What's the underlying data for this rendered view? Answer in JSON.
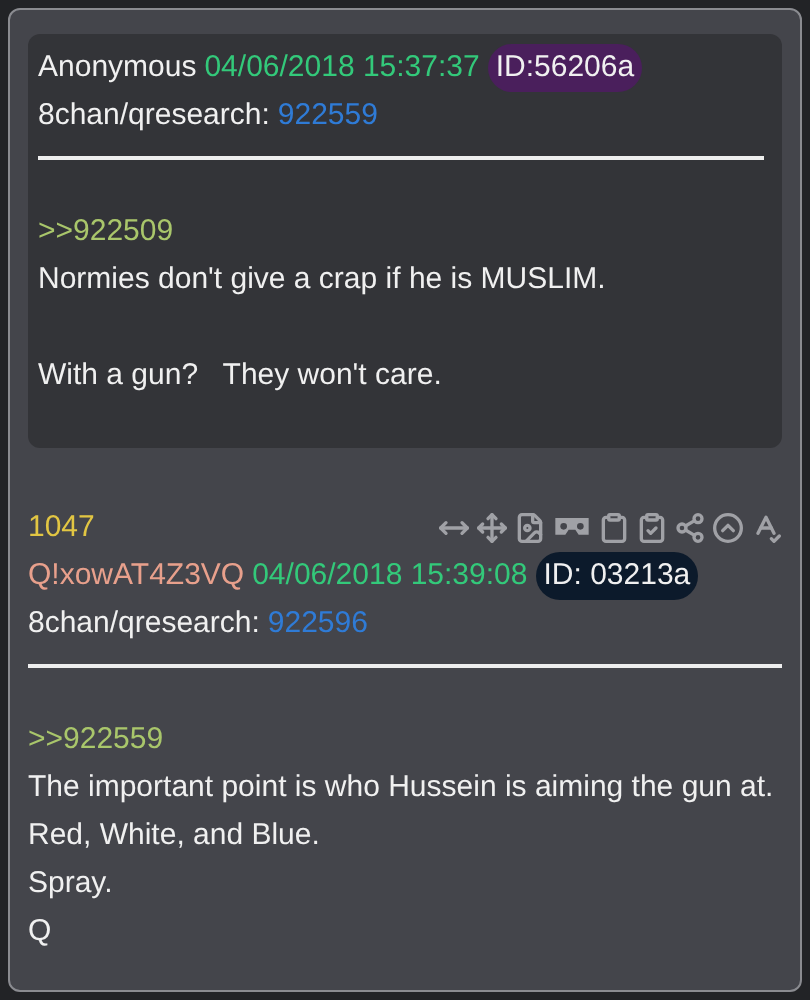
{
  "quoted_post": {
    "author": "Anonymous",
    "timestamp": "04/06/2018 15:37:37",
    "id_badge": "ID:56206a",
    "board": "8chan/qresearch:",
    "post_number": "922559",
    "reply_link": ">>922509",
    "paragraphs": [
      [
        "Normies don't give a crap if he is MUSLIM."
      ],
      [
        "With a gun?   They won't care."
      ]
    ]
  },
  "post": {
    "count": "1047",
    "tripcode": "Q!xowAT4Z3VQ",
    "timestamp": "04/06/2018 15:39:08",
    "id_badge": "ID: 03213a",
    "board": "8chan/qresearch:",
    "post_number": "922596",
    "reply_link": ">>922559",
    "paragraphs": [
      [
        "The important point is who Hussein is aiming the gun at.",
        "Red, White, and Blue.",
        "Spray.",
        "Q"
      ]
    ],
    "toolbar": [
      {
        "kind": "resize"
      },
      {
        "kind": "move"
      },
      {
        "kind": "image"
      },
      {
        "kind": "viewer"
      },
      {
        "kind": "clipboard"
      },
      {
        "kind": "clipboard-check"
      },
      {
        "kind": "share"
      },
      {
        "kind": "up"
      },
      {
        "kind": "spellcheck"
      }
    ]
  }
}
